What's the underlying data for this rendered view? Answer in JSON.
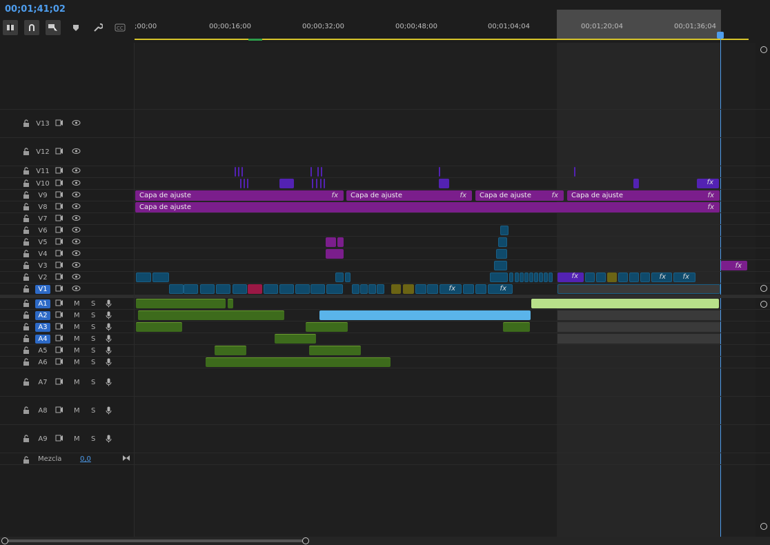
{
  "timecode": "00;01;41;02",
  "toolbar": {
    "icons": [
      "insert-overwrite-icon",
      "snap-icon",
      "linked-selection-icon",
      "marker-icon",
      "wrench-icon",
      "captions-icon"
    ]
  },
  "ruler": {
    "ticks": [
      ";00;00",
      "00;00;16;00",
      "00;00;32;00",
      "00;00;48;00",
      "00;01;04;04",
      "00;01;20;04",
      "00;01;36;04"
    ]
  },
  "tracks": {
    "video": [
      "V13",
      "V12",
      "V11",
      "V10",
      "V9",
      "V8",
      "V7",
      "V6",
      "V5",
      "V4",
      "V3",
      "V2",
      "V1"
    ],
    "audio": [
      "A1",
      "A2",
      "A3",
      "A4",
      "A5",
      "A6",
      "A7",
      "A8",
      "A9"
    ],
    "audio_m": "M",
    "audio_s": "S",
    "mix_label": "Mezcla",
    "mix_value": "0,0"
  },
  "clips": {
    "adjust_label": "Capa de ajuste",
    "fx_label": "fx"
  },
  "colors": {
    "accent": "#4e9ded",
    "adjust_layer": "#7b1e8c",
    "audio_green": "#3d6b1c",
    "audio_blue": "#5ab4ea",
    "video_teal": "#0f4a6b"
  }
}
